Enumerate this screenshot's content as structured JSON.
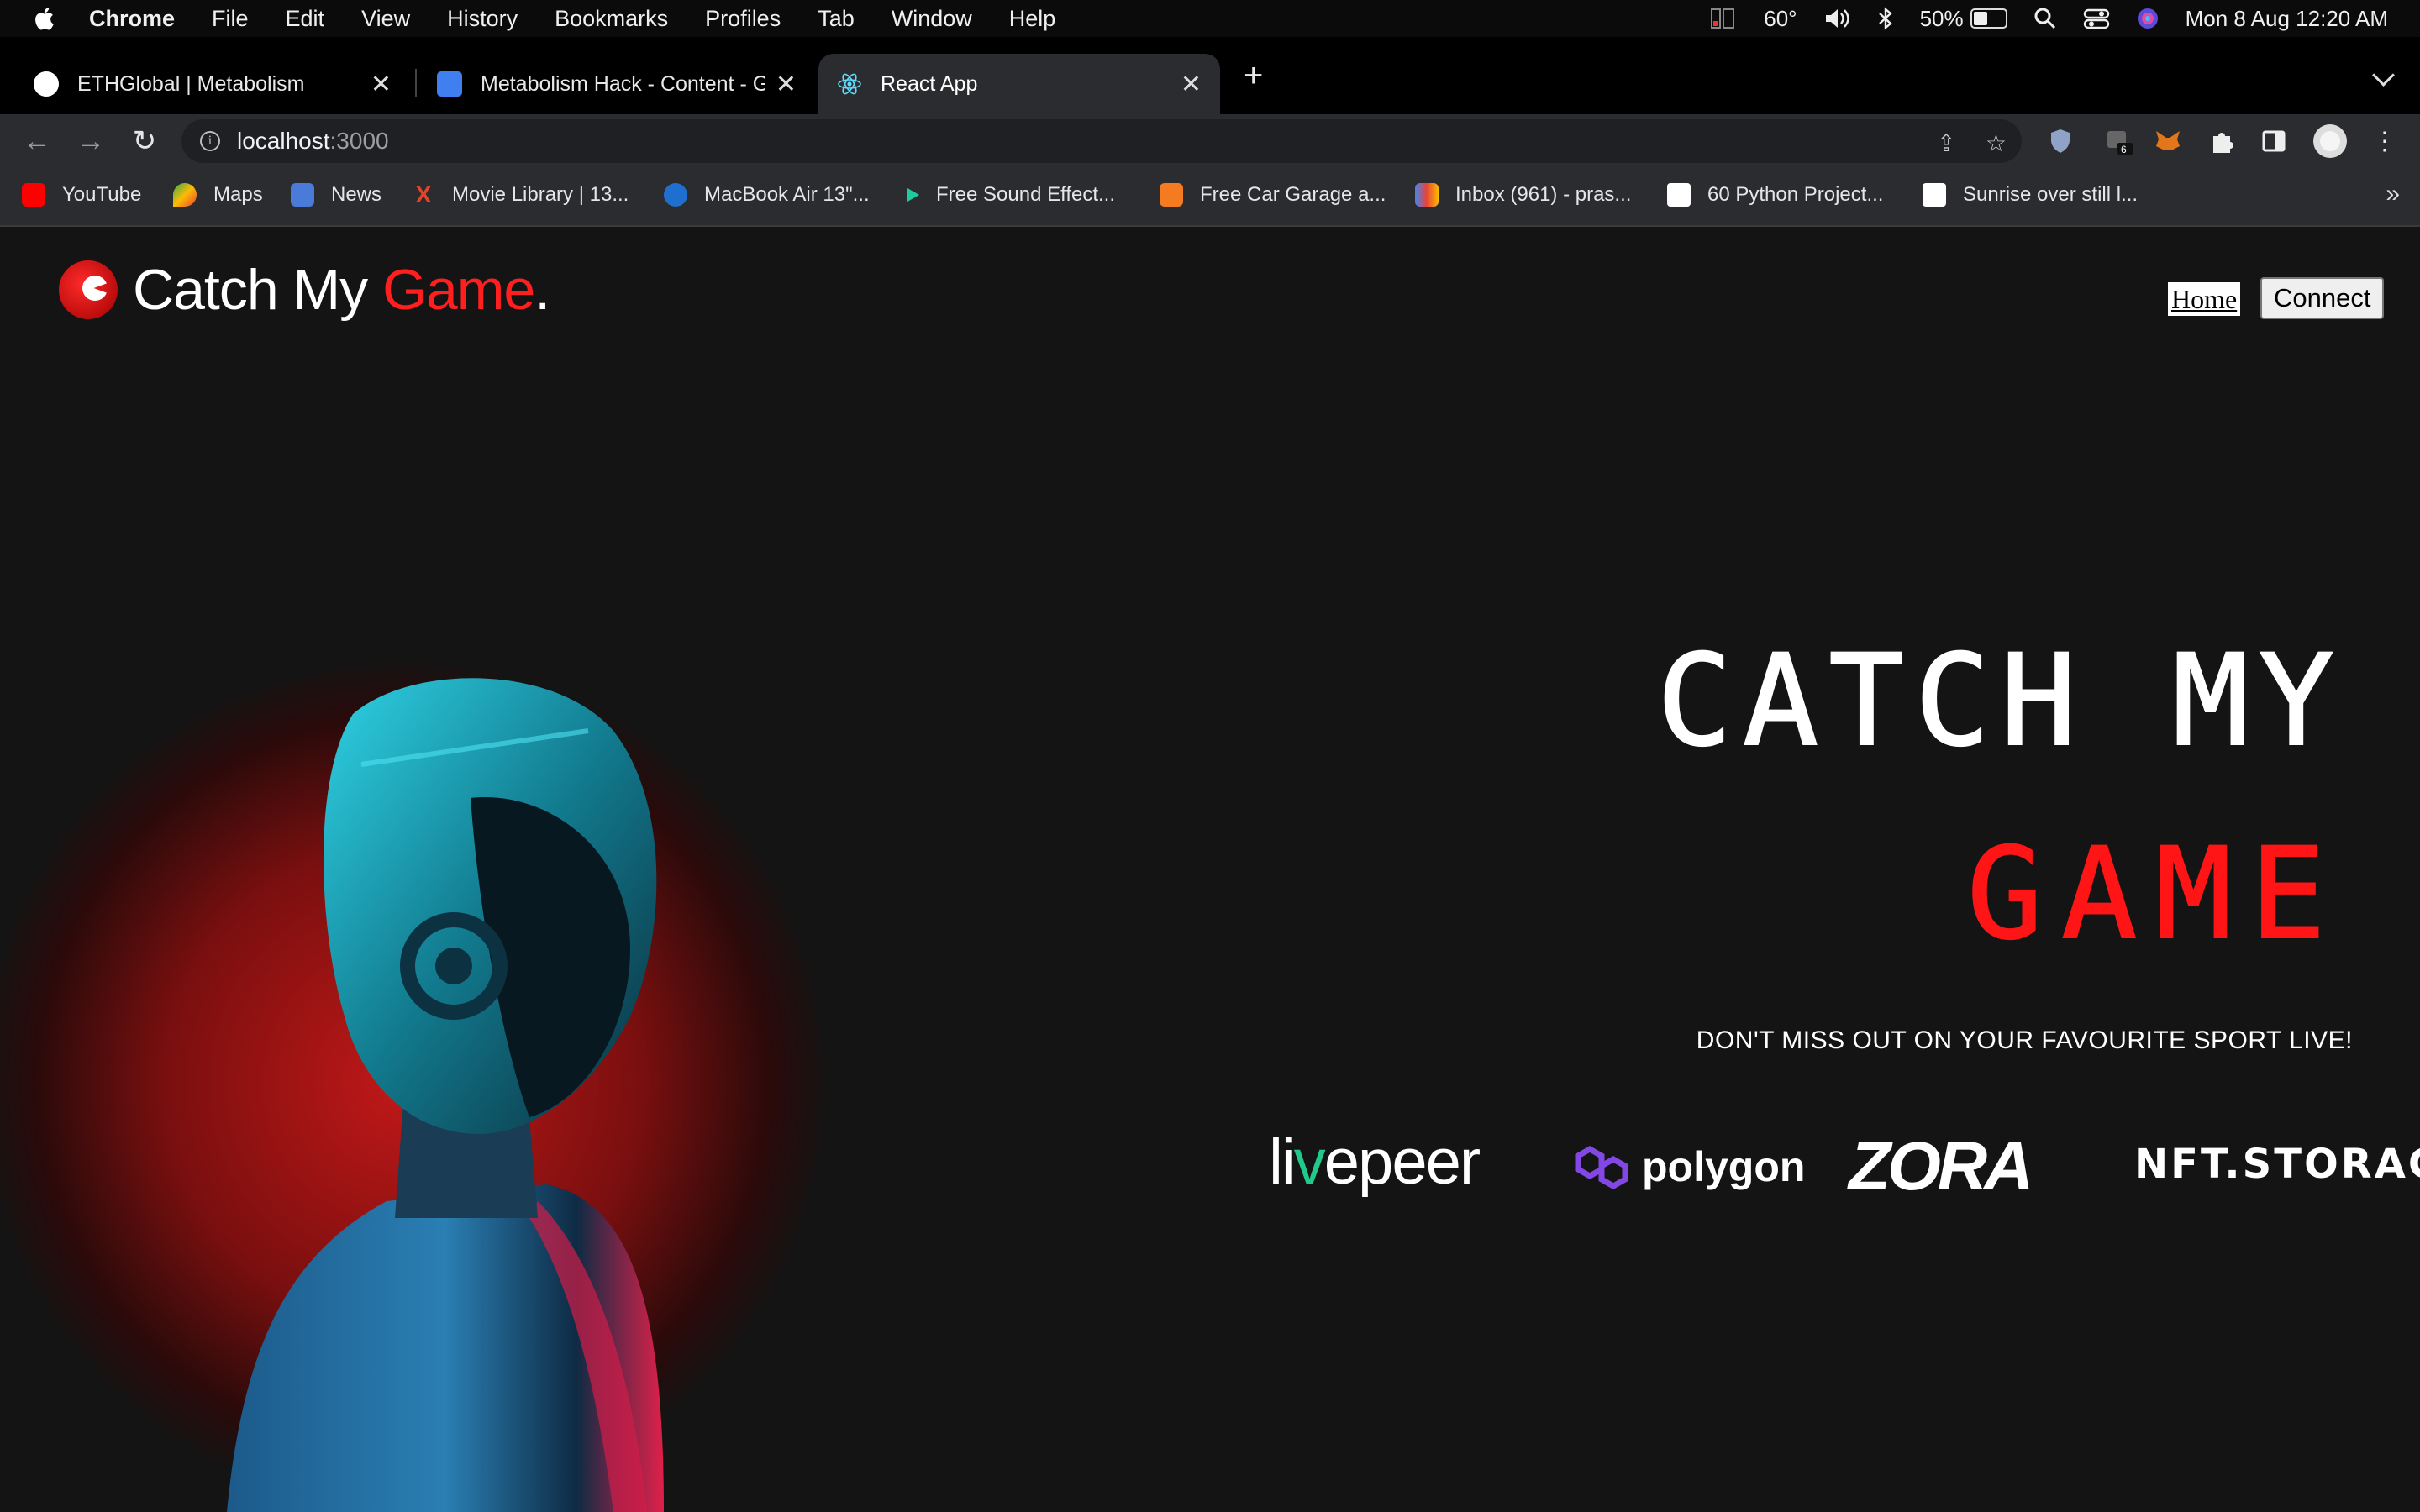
{
  "menubar": {
    "app": "Chrome",
    "items": [
      "File",
      "Edit",
      "View",
      "History",
      "Bookmarks",
      "Profiles",
      "Tab",
      "Window",
      "Help"
    ],
    "temperature": "60°",
    "battery": "50%",
    "datetime": "Mon 8 Aug  12:20 AM"
  },
  "tabs": [
    {
      "title": "ETHGlobal | Metabolism",
      "active": false
    },
    {
      "title": "Metabolism Hack - Content - G",
      "active": false
    },
    {
      "title": "React App",
      "active": true
    }
  ],
  "newtab": "+",
  "address": {
    "host": "localhost",
    "port": ":3000"
  },
  "extensions": {
    "badge": "6"
  },
  "bookmarks": [
    "YouTube",
    "Maps",
    "News",
    "Movie Library | 13...",
    "MacBook Air 13\"...",
    "Free Sound Effect...",
    "Free Car Garage a...",
    "Inbox (961) - pras...",
    "60 Python Project...",
    "Sunrise over still l..."
  ],
  "bookmarks_more": "»",
  "site": {
    "logo_white": "Catch My ",
    "logo_red": "Game",
    "logo_dot": ".",
    "nav_home": "Home",
    "nav_connect": "Connect",
    "hero_line1": "CATCH MY",
    "hero_line2": "GAME",
    "tagline": "DON'T MISS OUT ON YOUR FAVOURITE SPORT LIVE!",
    "sponsors": {
      "livepeer_a": "li",
      "livepeer_dots": "v",
      "livepeer_b": "epeer",
      "polygon": "polygon",
      "zora": "ZORA",
      "nft": "NFT.STORAGE"
    }
  },
  "colors": {
    "accent": "#ff1f1f",
    "page_bg": "#141414",
    "livepeer_green": "#22c98c",
    "polygon_purple": "#8247e5"
  }
}
